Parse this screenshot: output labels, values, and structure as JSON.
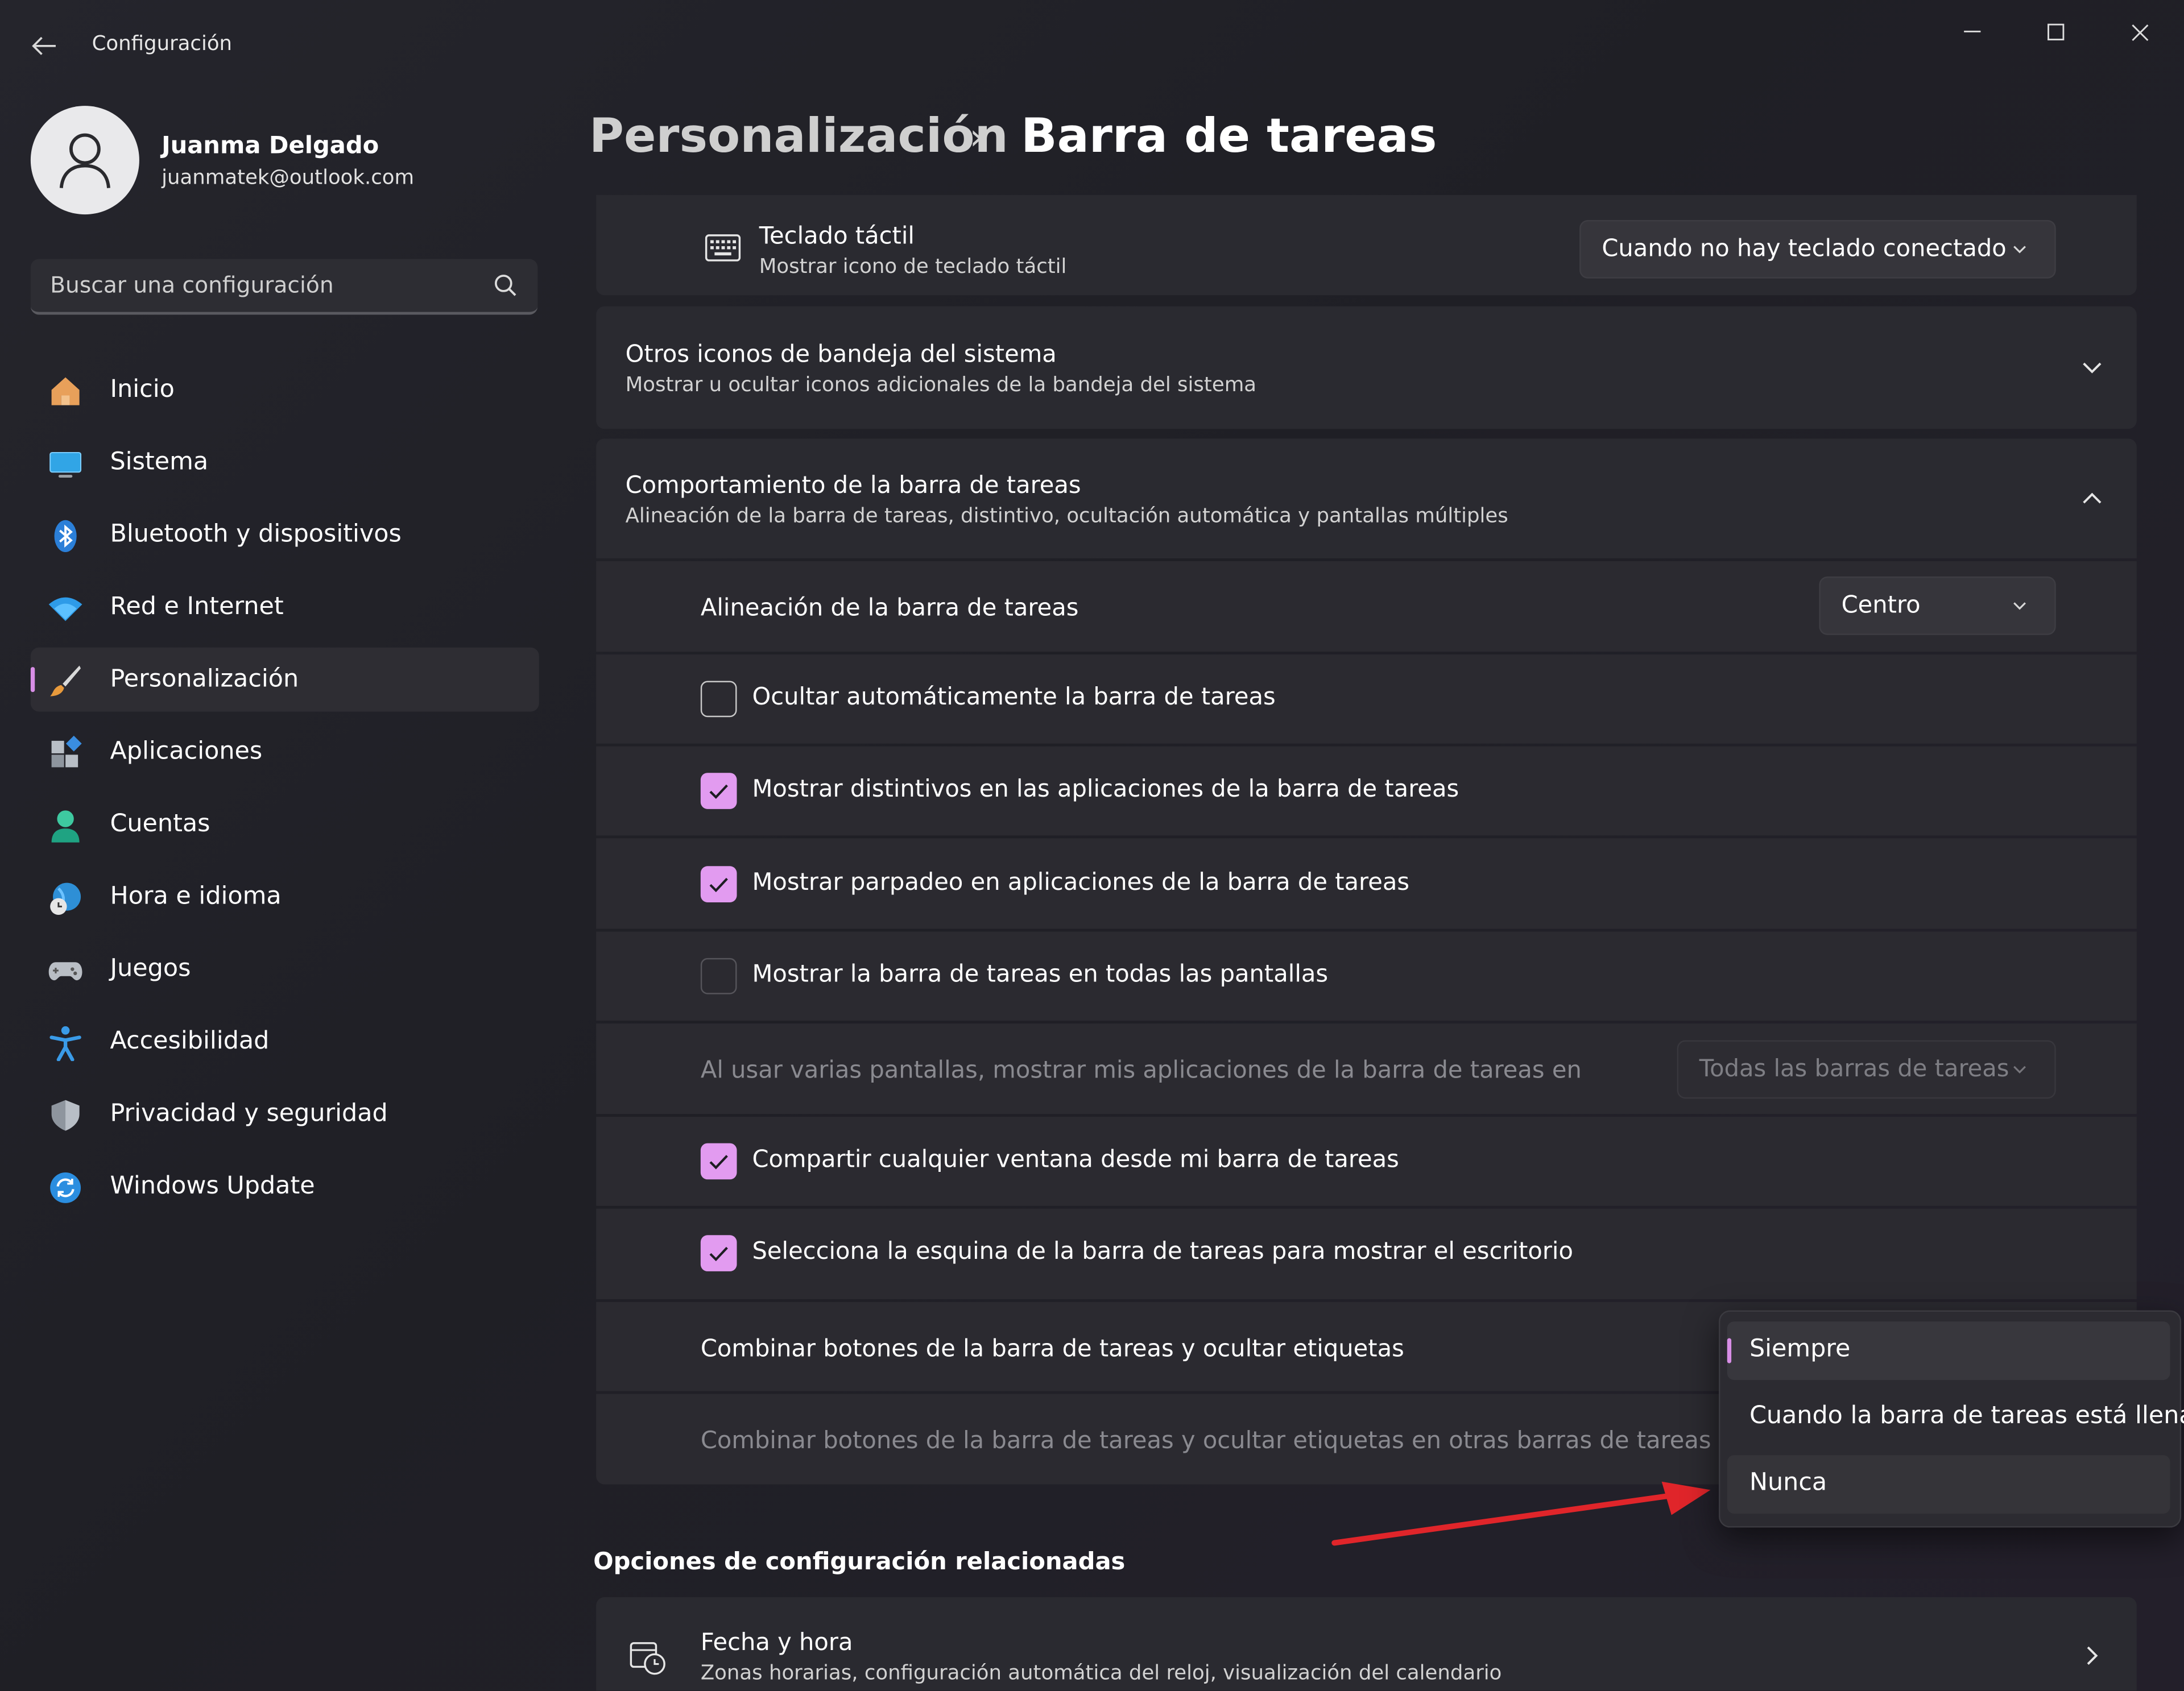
{
  "window": {
    "title": "Configuración"
  },
  "profile": {
    "name": "Juanma Delgado",
    "email": "juanmatek@outlook.com"
  },
  "search": {
    "placeholder": "Buscar una configuración"
  },
  "nav": {
    "items": [
      {
        "label": "Inicio",
        "icon": "home-icon"
      },
      {
        "label": "Sistema",
        "icon": "monitor-icon"
      },
      {
        "label": "Bluetooth y dispositivos",
        "icon": "bluetooth-icon"
      },
      {
        "label": "Red e Internet",
        "icon": "wifi-icon"
      },
      {
        "label": "Personalización",
        "icon": "brush-icon",
        "active": true
      },
      {
        "label": "Aplicaciones",
        "icon": "apps-icon"
      },
      {
        "label": "Cuentas",
        "icon": "person-icon"
      },
      {
        "label": "Hora e idioma",
        "icon": "globe-clock-icon"
      },
      {
        "label": "Juegos",
        "icon": "gamepad-icon"
      },
      {
        "label": "Accesibilidad",
        "icon": "accessibility-icon"
      },
      {
        "label": "Privacidad y seguridad",
        "icon": "shield-icon"
      },
      {
        "label": "Windows Update",
        "icon": "update-icon"
      }
    ]
  },
  "header": {
    "parent": "Personalización",
    "separator": "›",
    "current": "Barra de tareas"
  },
  "touch_keyboard": {
    "title": "Teclado táctil",
    "subtitle": "Mostrar icono de teclado táctil",
    "value": "Cuando no hay teclado conectado"
  },
  "tray_icons": {
    "title": "Otros iconos de bandeja del sistema",
    "subtitle": "Mostrar u ocultar iconos adicionales de la bandeja del sistema"
  },
  "behavior": {
    "title": "Comportamiento de la barra de tareas",
    "subtitle": "Alineación de la barra de tareas, distintivo, ocultación automática y pantallas múltiples",
    "alignment_label": "Alineación de la barra de tareas",
    "alignment_value": "Centro",
    "autohide_label": "Ocultar automáticamente la barra de tareas",
    "autohide_checked": false,
    "badges_label": "Mostrar distintivos en las aplicaciones de la barra de tareas",
    "badges_checked": true,
    "flashing_label": "Mostrar parpadeo en aplicaciones de la barra de tareas",
    "flashing_checked": true,
    "all_displays_label": "Mostrar la barra de tareas en todas las pantallas",
    "all_displays_checked": false,
    "multi_display_label": "Al usar varias pantallas, mostrar mis aplicaciones de la barra de tareas en",
    "multi_display_value": "Todas las barras de tareas",
    "share_label": "Compartir cualquier ventana desde mi barra de tareas",
    "share_checked": true,
    "corner_label": "Selecciona la esquina de la barra de tareas para mostrar el escritorio",
    "corner_checked": true,
    "combine_label": "Combinar botones de la barra de tareas y ocultar etiquetas",
    "combine_other_label": "Combinar botones de la barra de tareas y ocultar etiquetas en otras barras de tareas"
  },
  "combine_popup": {
    "options": [
      "Siempre",
      "Cuando la barra de tareas está llena",
      "Nunca"
    ],
    "selected": "Siempre"
  },
  "related": {
    "title": "Opciones de configuración relacionadas",
    "date_time_title": "Fecha y hora",
    "date_time_subtitle": "Zonas horarias, configuración automática del reloj, visualización del calendario"
  },
  "colors": {
    "accent": "#e29bf0",
    "annotation_arrow": "#e0252a"
  }
}
